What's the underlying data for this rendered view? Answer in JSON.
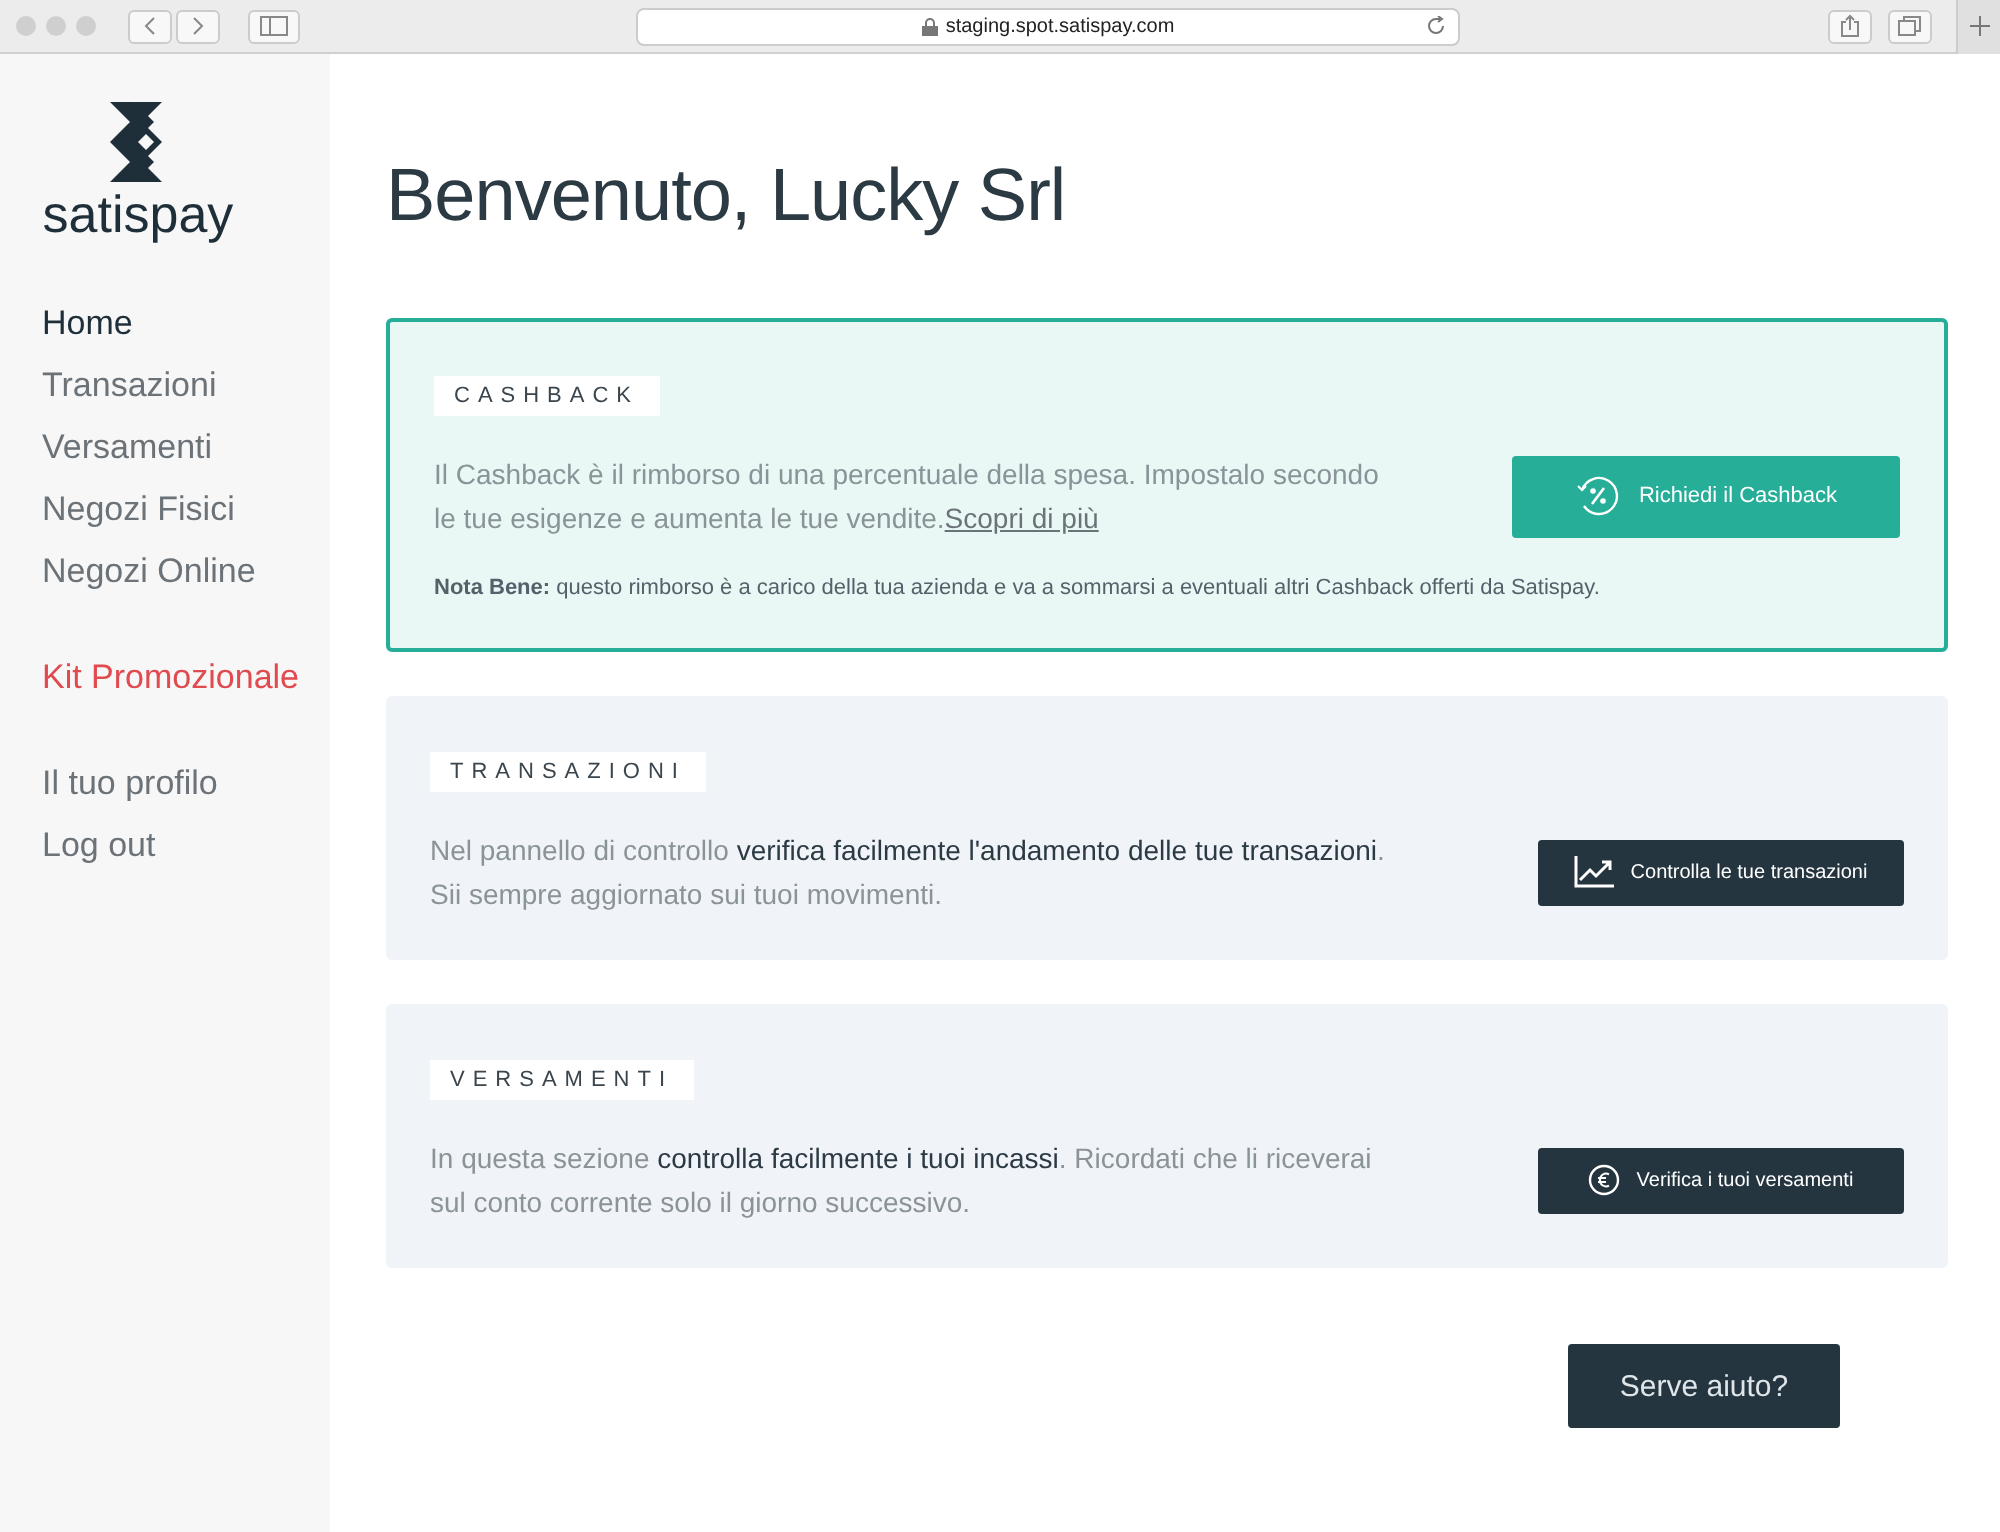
{
  "browser": {
    "url": "staging.spot.satispay.com"
  },
  "sidebar": {
    "logo_text": "satispay",
    "groups": [
      [
        {
          "label": "Home",
          "selected": true,
          "kind": "nav"
        },
        {
          "label": "Transazioni",
          "selected": false,
          "kind": "nav"
        },
        {
          "label": "Versamenti",
          "selected": false,
          "kind": "nav"
        },
        {
          "label": "Negozi Fisici",
          "selected": false,
          "kind": "nav"
        },
        {
          "label": "Negozi Online",
          "selected": false,
          "kind": "nav"
        }
      ],
      [
        {
          "label": "Kit Promozionale",
          "selected": false,
          "kind": "promo"
        }
      ],
      [
        {
          "label": "Il tuo profilo",
          "selected": false,
          "kind": "nav"
        },
        {
          "label": "Log out",
          "selected": false,
          "kind": "nav"
        }
      ]
    ]
  },
  "heading": {
    "greeting": "Benvenuto,",
    "name": "Lucky Srl"
  },
  "cards": [
    {
      "kind": "highlight",
      "title": "CASHBACK",
      "text": "Il Cashback è il rimborso di una percentuale della spesa. Impostalo secondo le tue esigenze e aumenta le tue vendite.",
      "link": "Scopri di più",
      "note": "**Nota Bene:** questo rimborso è a carico della tua azienda e va a sommarsi a eventuali altri Cashback offerti da Satispay.",
      "button": "Richiedi il Cashback"
    },
    {
      "kind": "plain",
      "title": "TRANSAZIONI",
      "text": "Nel pannello di controllo **verifica facilmente l'andamento delle tue transazioni**. Sii sempre aggiornato sui tuoi movimenti.",
      "button": "Controlla le tue transazioni"
    },
    {
      "kind": "plain",
      "title": "VERSAMENTI",
      "text": "In questa sezione **controlla facilmente i tuoi incassi**. Ricordati che li riceverai sul conto corrente solo il giorno successivo.",
      "button": "Verifica i tuoi versamenti"
    }
  ],
  "help_button": "Serve aiuto?"
}
